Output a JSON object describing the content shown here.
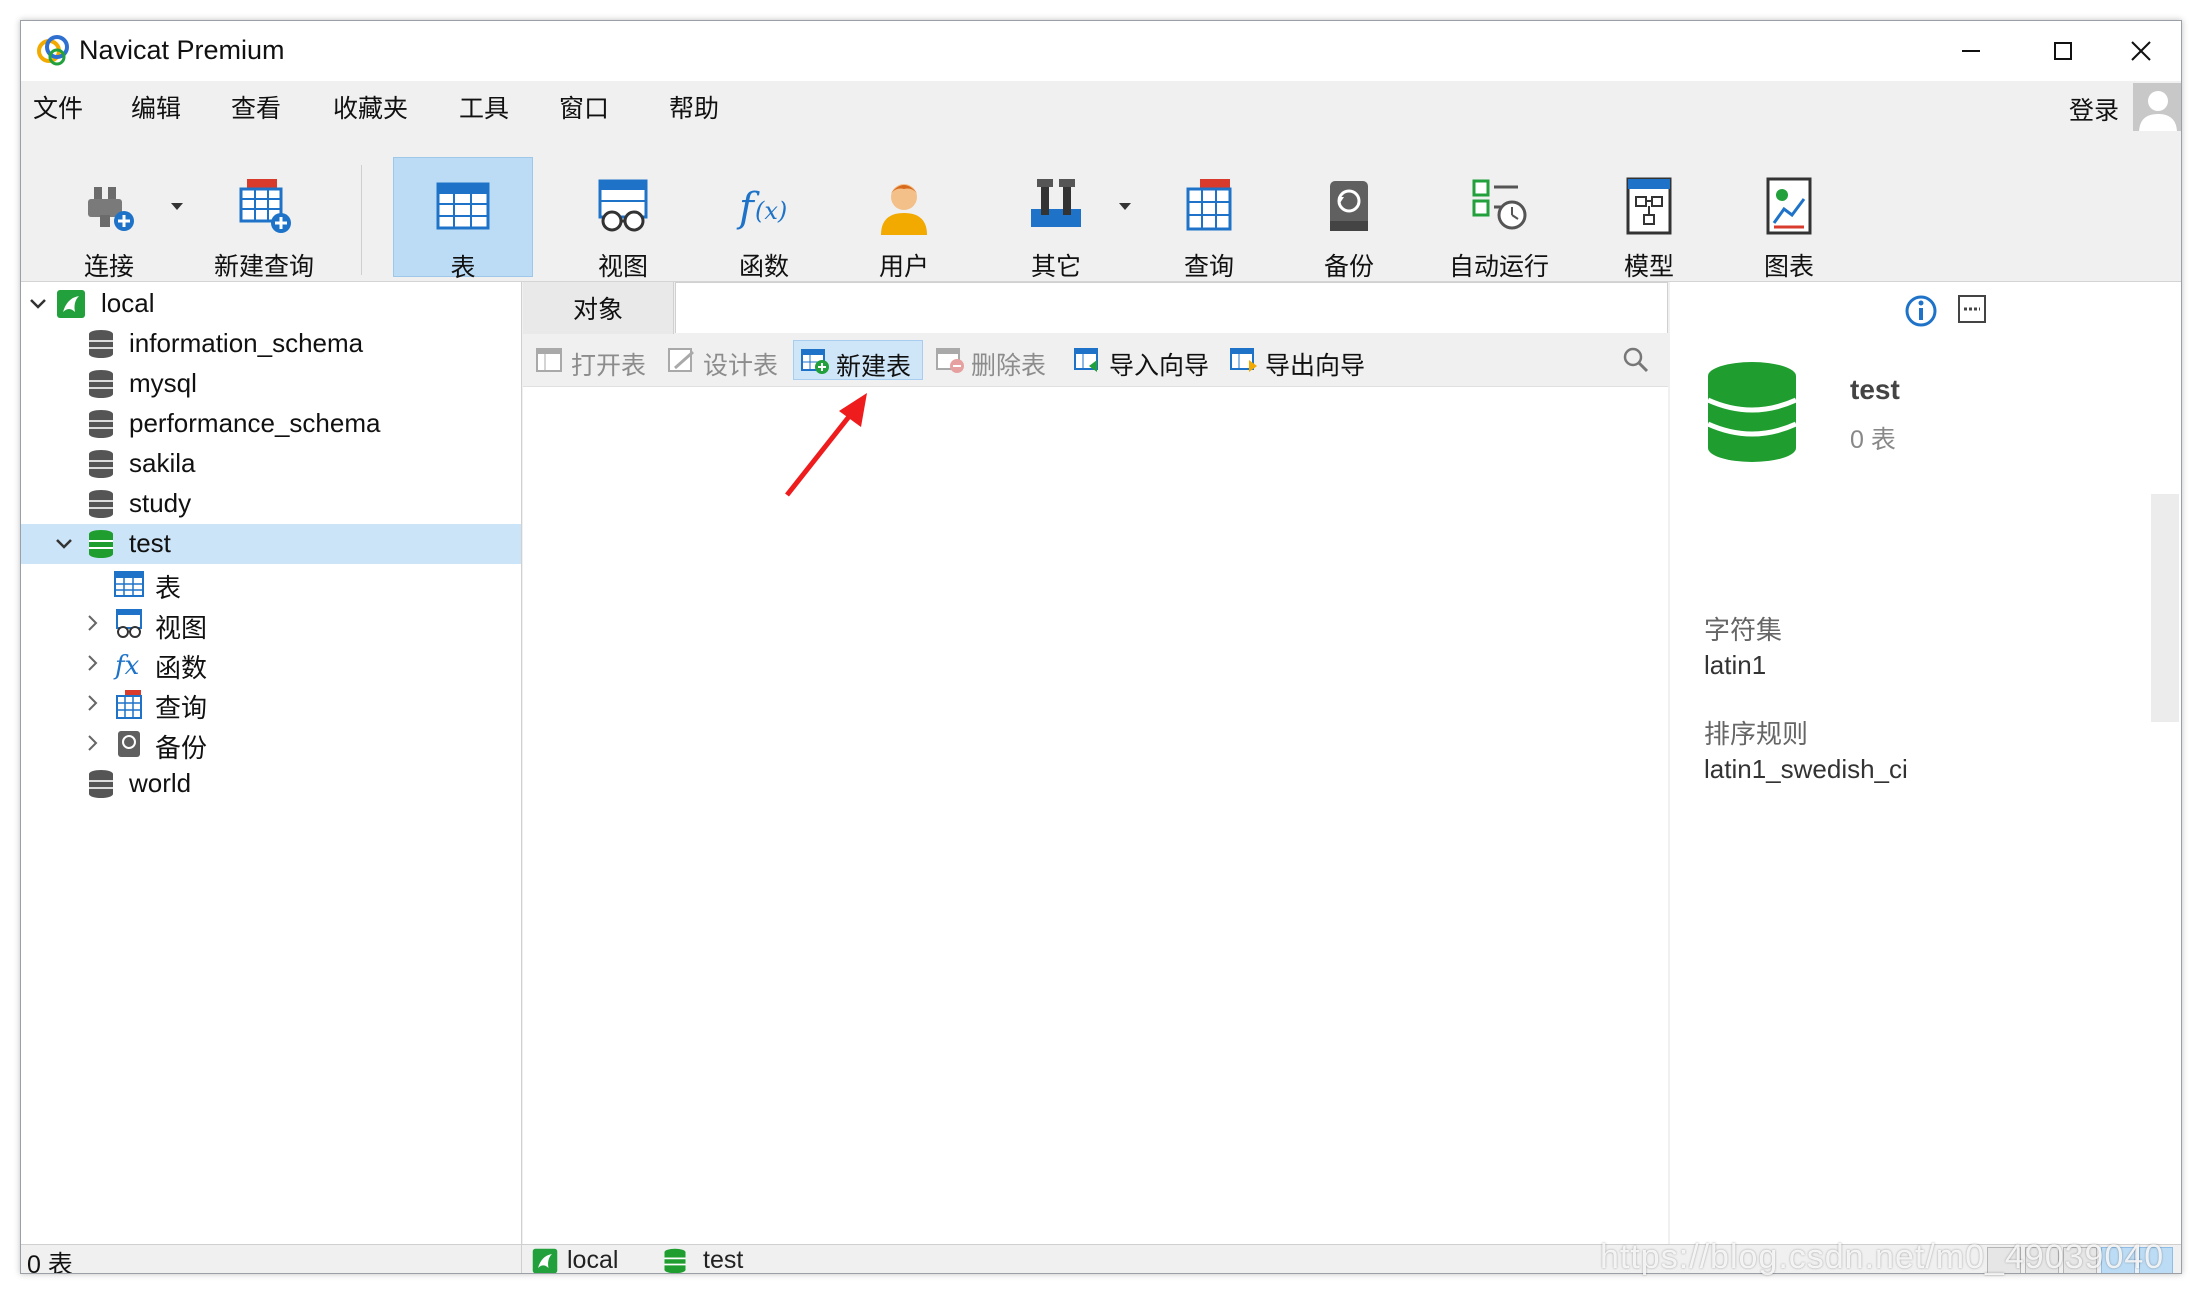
{
  "window": {
    "title": "Navicat Premium"
  },
  "menu": {
    "items": [
      "文件",
      "编辑",
      "查看",
      "收藏夹",
      "工具",
      "窗口",
      "帮助"
    ],
    "login": "登录"
  },
  "toolbar": {
    "items": [
      {
        "label": "连接",
        "icon": "plug-icon"
      },
      {
        "label": "新建查询",
        "icon": "new-query-icon"
      },
      {
        "label": "表",
        "icon": "table-icon"
      },
      {
        "label": "视图",
        "icon": "view-icon"
      },
      {
        "label": "函数",
        "icon": "function-icon"
      },
      {
        "label": "用户",
        "icon": "user-icon"
      },
      {
        "label": "其它",
        "icon": "tools-icon"
      },
      {
        "label": "查询",
        "icon": "query-icon"
      },
      {
        "label": "备份",
        "icon": "backup-icon"
      },
      {
        "label": "自动运行",
        "icon": "schedule-icon"
      },
      {
        "label": "模型",
        "icon": "model-icon"
      },
      {
        "label": "图表",
        "icon": "chart-icon"
      }
    ],
    "active": "表"
  },
  "tree": {
    "connection": "local",
    "databases": [
      "information_schema",
      "mysql",
      "performance_schema",
      "sakila",
      "study",
      "test"
    ],
    "last_database": "world",
    "children": [
      "表",
      "视图",
      "函数",
      "查询",
      "备份"
    ]
  },
  "center": {
    "tab": "对象",
    "actions": [
      "打开表",
      "设计表",
      "新建表",
      "删除表",
      "导入向导",
      "导出向导"
    ]
  },
  "right": {
    "db_name": "test",
    "table_count": "0 表",
    "charset_label": "字符集",
    "charset": "latin1",
    "collation_label": "排序规则",
    "collation": "latin1_swedish_ci"
  },
  "status": {
    "left": "0 表",
    "connection": "local",
    "database": "test"
  },
  "watermark": "https://blog.csdn.net/m0_49039040",
  "colors": {
    "accent": "#1e73c8",
    "db_green": "#1f9e2f",
    "selected": "#cce4f7",
    "active_tool": "#bcdcf5"
  }
}
